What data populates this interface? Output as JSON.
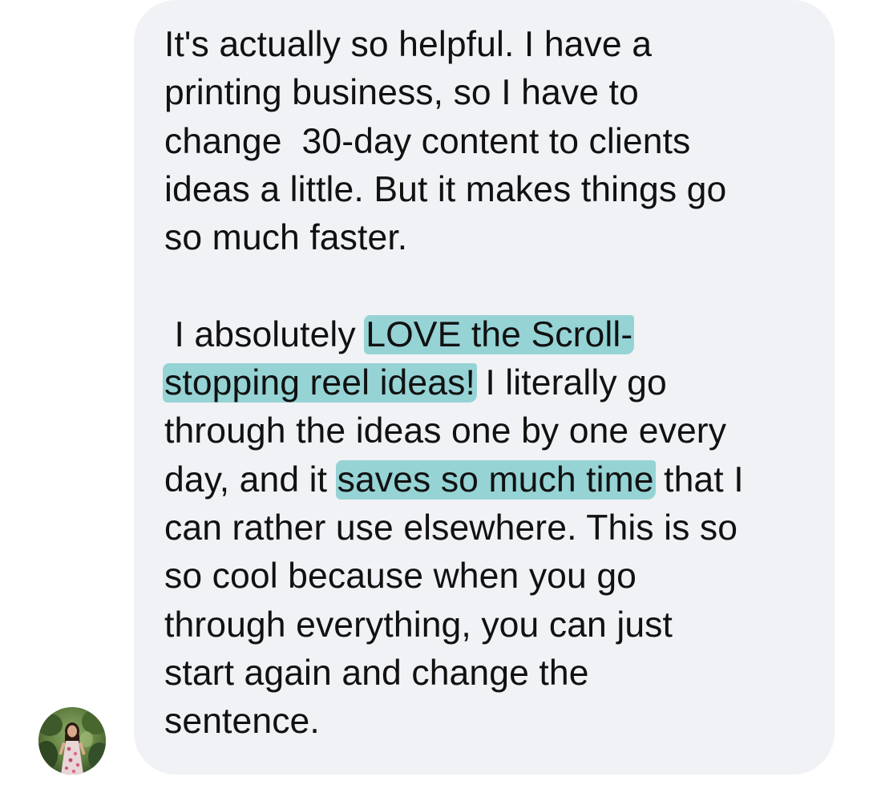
{
  "message": {
    "p1": {
      "l1": "It's actually so helpful. I have a",
      "l2": "printing business, so I have to",
      "l3": "change  30-day content to clients",
      "l4": "ideas a little. But it makes things go",
      "l5": "so much faster."
    },
    "p2": {
      "l1a": " I absolutely ",
      "l1hl": "LOVE the Scroll-",
      "l2hl": "stopping reel ideas!",
      "l2b": " I literally go",
      "l3": "through the ideas one by one every",
      "l4a": "day, and it ",
      "l4hl": "saves so much time",
      "l4b": " that I",
      "l5": "can rather use elsewhere. This is so",
      "l6": "so cool because when you go",
      "l7": "through everything, you can just",
      "l8": "start again and change the",
      "l9": "sentence."
    },
    "highlight_color": "#96d3d5",
    "bubble_color": "#f0f2f5"
  },
  "sender": {
    "avatar": "profile-photo"
  }
}
